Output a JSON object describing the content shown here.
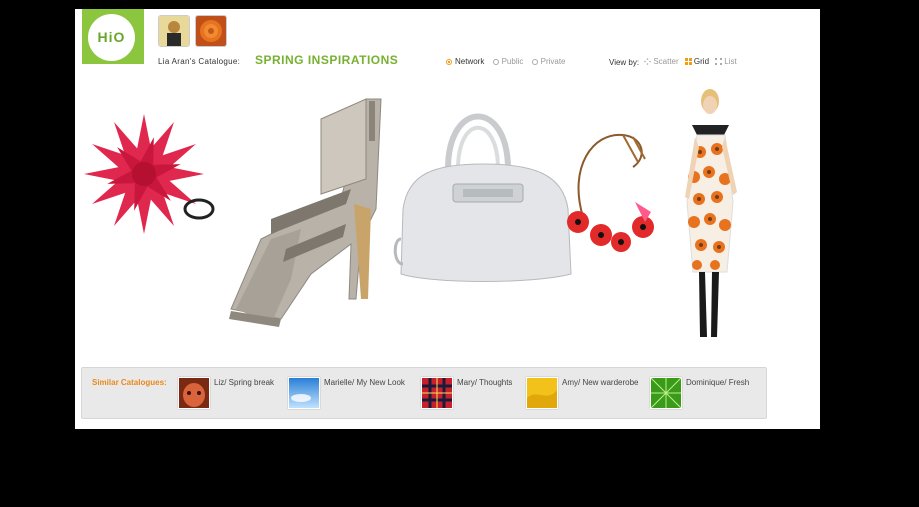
{
  "logo": {
    "text": "HiO"
  },
  "header": {
    "catalogue_label": "Lia Aran's Catalogue:",
    "catalogue_title": "SPRING INSPIRATIONS"
  },
  "visibility": {
    "options": [
      {
        "label": "Network",
        "selected": true
      },
      {
        "label": "Public",
        "selected": false
      },
      {
        "label": "Private",
        "selected": false
      }
    ]
  },
  "view_by": {
    "label": "View by:",
    "options": [
      {
        "label": "Scatter",
        "active": false,
        "icon": "scatter-icon"
      },
      {
        "label": "Grid",
        "active": true,
        "icon": "grid-icon"
      },
      {
        "label": "List",
        "active": false,
        "icon": "list-icon"
      }
    ]
  },
  "similar": {
    "label": "Similar Catalogues:",
    "items": [
      {
        "name": "Liz/ Spring break",
        "thumb": "face"
      },
      {
        "name": "Marielle/ My New Look",
        "thumb": "sky"
      },
      {
        "name": "Mary/ Thoughts",
        "thumb": "plaid"
      },
      {
        "name": "Amy/ New warderobe",
        "thumb": "yellow"
      },
      {
        "name": "Dominique/ Fresh",
        "thumb": "leaf"
      }
    ]
  },
  "colors": {
    "accent_green": "#77b130",
    "accent_orange": "#e8891b",
    "logo_green": "#8cc63f"
  }
}
